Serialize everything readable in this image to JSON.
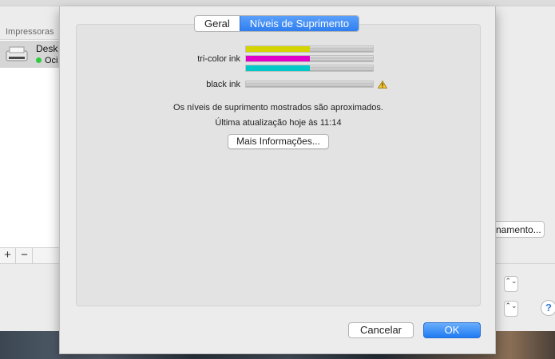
{
  "background": {
    "sidebar_header": "Impressoras",
    "printer_name": "Desk",
    "printer_status": "Oci",
    "add_label": "+",
    "remove_label": "−",
    "right_button_label": "namento...",
    "stepper_symbol": "⌃⌄",
    "help_label": "?"
  },
  "dialog": {
    "tabs": [
      {
        "label": "Geral",
        "active": false
      },
      {
        "label": "Níveis de Suprimento",
        "active": true
      }
    ],
    "supplies": [
      {
        "label": "tri-color ink",
        "colors": [
          {
            "name": "yellow",
            "color": "#d4d400",
            "level": 0.5
          },
          {
            "name": "magenta",
            "color": "#e000c8",
            "level": 0.5
          },
          {
            "name": "cyan",
            "color": "#00c8c8",
            "level": 0.5
          }
        ]
      },
      {
        "label": "black ink",
        "colors": [
          {
            "name": "black",
            "color": "#222222",
            "level": 0.0
          }
        ],
        "warning": true
      }
    ],
    "approx_note": "Os níveis de suprimento mostrados são aproximados.",
    "last_update": "Última atualização hoje às 11:14",
    "more_info_button": "Mais Informações...",
    "cancel_button": "Cancelar",
    "ok_button": "OK",
    "accent_color": "#2f7ef0",
    "warning_icon": "warning-triangle-icon"
  }
}
